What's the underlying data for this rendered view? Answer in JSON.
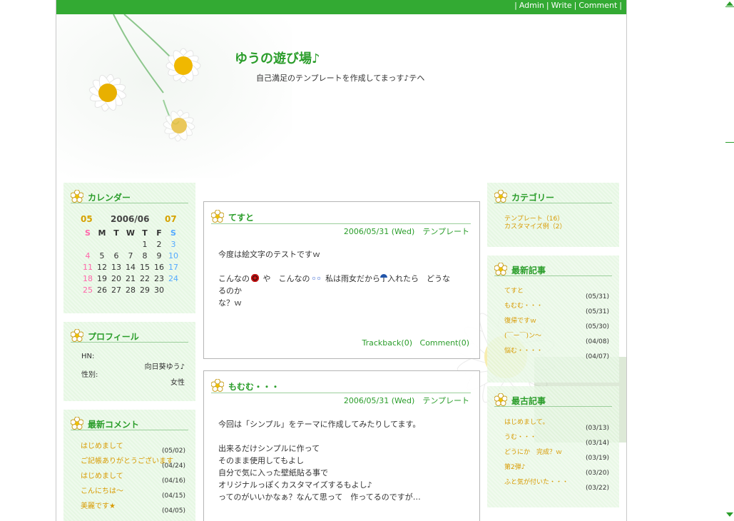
{
  "toplinks": {
    "admin": "Admin",
    "write": "Write",
    "comment": "Comment"
  },
  "site": {
    "title": "ゆうの遊び場♪",
    "description": "自己満足のテンプレートを作成してまっす♪テヘ"
  },
  "calendar": {
    "title": "カレンダー",
    "prev": "05",
    "month": "2006/06",
    "next": "07",
    "dow": [
      "S",
      "M",
      "T",
      "W",
      "T",
      "F",
      "S"
    ],
    "weeks": [
      [
        "",
        "",
        "",
        "",
        "1",
        "2",
        "3"
      ],
      [
        "4",
        "5",
        "6",
        "7",
        "8",
        "9",
        "10"
      ],
      [
        "11",
        "12",
        "13",
        "14",
        "15",
        "16",
        "17"
      ],
      [
        "18",
        "19",
        "20",
        "21",
        "22",
        "23",
        "24"
      ],
      [
        "25",
        "26",
        "27",
        "28",
        "29",
        "30",
        ""
      ]
    ]
  },
  "profile": {
    "title": "プロフィール",
    "hn_label": "HN:",
    "hn_value": "向日葵ゆう♪",
    "sex_label": "性別:",
    "sex_value": "女性"
  },
  "recent_comments": {
    "title": "最新コメント",
    "items": [
      {
        "text": "はじめまして",
        "date": "(05/02)"
      },
      {
        "text": "ご記帳ありがとうございます",
        "date": "(04/24)"
      },
      {
        "text": "はじめまして",
        "date": "(04/16)"
      },
      {
        "text": "こんにちは～",
        "date": "(04/15)"
      },
      {
        "text": "美麗です★",
        "date": "(04/05)"
      }
    ]
  },
  "categories": {
    "title": "カテゴリー",
    "items": [
      "テンプレート（16）",
      "カスタマイズ例（2）"
    ]
  },
  "latest_posts": {
    "title": "最新記事",
    "items": [
      {
        "text": "てすと",
        "date": "(05/31)"
      },
      {
        "text": "もむむ・・・",
        "date": "(05/31)"
      },
      {
        "text": "復帰ですｗ",
        "date": "(05/30)"
      },
      {
        "text": "(￣ー￣)ン～",
        "date": "(04/08)"
      },
      {
        "text": "悩む・・・・",
        "date": "(04/07)"
      }
    ]
  },
  "oldest_posts": {
    "title": "最古記事",
    "items": [
      {
        "text": "はじめまして。",
        "date": "(03/13)"
      },
      {
        "text": "うむ・・・",
        "date": "(03/14)"
      },
      {
        "text": "どうにか　完成？ｗ",
        "date": "(03/19)"
      },
      {
        "text": "第2弾♪",
        "date": "(03/20)"
      },
      {
        "text": "ふと気が付いた・・・",
        "date": "(03/22)"
      }
    ]
  },
  "posts": [
    {
      "title": "てすと",
      "meta": "2006/05/31 (Wed)　テンプレート",
      "line1": "今度は絵文字のテストですｗ",
      "line2a": "こんなの",
      "line2b": "や　こんなの",
      "line2c": "私は雨女だから",
      "line2d": "入れたら　どうなるのか",
      "line3": "な？ｗ",
      "trackback": "Trackback(0)",
      "comment": "Comment(0)"
    },
    {
      "title": "もむむ・・・",
      "meta": "2006/05/31 (Wed)　テンプレート",
      "lines": [
        "今回は「シンプル」をテーマに作成してみたりしてます。",
        "",
        "出来るだけシンプルに作って",
        "そのまま使用してもよし",
        "自分で気に入った壁紙貼る事で",
        "オリジナルっぽくカスタマイズするもよし♪",
        "ってのがいいかなぁ？なんて思って　作ってるのですが…"
      ]
    }
  ]
}
